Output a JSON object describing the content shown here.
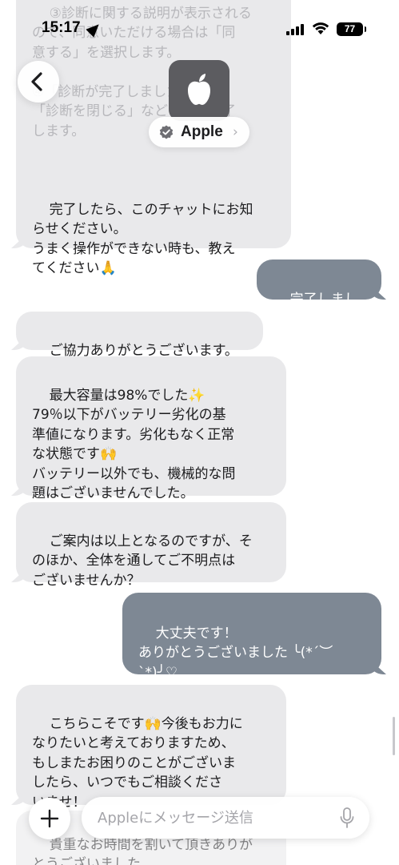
{
  "status_bar": {
    "time": "15:17",
    "battery": "77"
  },
  "header": {
    "contact_name": "Apple",
    "chevron": "›",
    "icons": [
      "back-chevron-icon",
      "apple-logo-icon",
      "verified-badge-icon"
    ]
  },
  "messages": [
    {
      "id": "m1",
      "side": "incoming",
      "faded": "③診断に関する説明が表示される\nので、同意いただける場合は「同\n意する」を選択します。\n\n④「診断が完了しました」>\n「診断を閉じる」などを押し終了\nします。",
      "text": "完了したら、このチャットにお知\nらせください。\nうまく操作ができない時も、教え\nてください🙏"
    },
    {
      "id": "m2",
      "side": "outgoing",
      "text": "完了しました"
    },
    {
      "id": "m3",
      "side": "incoming",
      "text": "ご協力ありがとうございます。"
    },
    {
      "id": "m4",
      "side": "incoming",
      "text": "最大容量は98%でした✨\n79％以下がバッテリー劣化の基\n準値になります。劣化もなく正常\nな状態です🙌\nバッテリー以外でも、機械的な問\n題はございませんでした。"
    },
    {
      "id": "m5",
      "side": "incoming",
      "text": "ご案内は以上となるのですが、そ\nのほか、全体を通してご不明点は\nございませんか？"
    },
    {
      "id": "m6",
      "side": "outgoing",
      "text": "大丈夫です！\nありがとうございました ╰(*´︶\n`*)╯♡"
    },
    {
      "id": "m7",
      "side": "incoming",
      "text": "こちらこそです🙌今後もお力に\nなりたいと考えておりますため、\nもしまたお困りのことがございま\nしたら、いつでもご相談くださ\nいませ！"
    },
    {
      "id": "m8",
      "side": "incoming",
      "text": "貴重なお時間を割いて頂きありが\nとうございました。"
    }
  ],
  "composer": {
    "placeholder": "Appleにメッセージ送信",
    "icons": [
      "plus-icon",
      "microphone-icon"
    ]
  },
  "colors": {
    "incoming_bubble": "#e9e9eb",
    "outgoing_bubble": "#7e8894",
    "text": "#1c1c1e"
  }
}
